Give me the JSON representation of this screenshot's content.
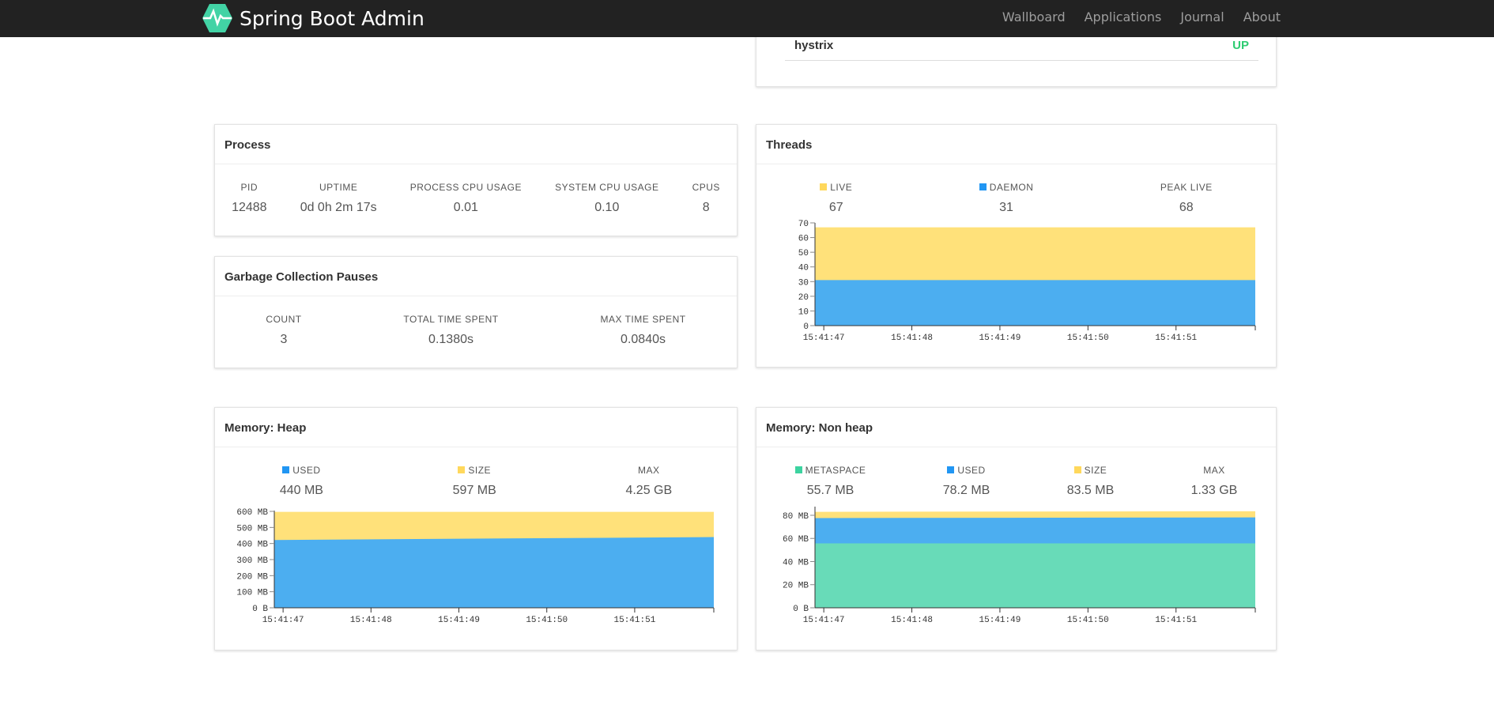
{
  "navbar": {
    "brand": "Spring Boot Admin",
    "links": [
      "Wallboard",
      "Applications",
      "Journal",
      " About"
    ]
  },
  "health": {
    "name": "hystrix",
    "status": "UP",
    "status_color": "#2ecc71"
  },
  "process": {
    "title": "Process",
    "stats": [
      {
        "label": "PID",
        "value": "12488"
      },
      {
        "label": "UPTIME",
        "value": "0d 0h 2m 17s"
      },
      {
        "label": "PROCESS CPU USAGE",
        "value": "0.01"
      },
      {
        "label": "SYSTEM CPU USAGE",
        "value": "0.10"
      },
      {
        "label": "CPUS",
        "value": "8"
      }
    ]
  },
  "gc": {
    "title": "Garbage Collection Pauses",
    "stats": [
      {
        "label": "COUNT",
        "value": "3"
      },
      {
        "label": "TOTAL TIME SPENT",
        "value": "0.1380s"
      },
      {
        "label": "MAX TIME SPENT",
        "value": "0.0840s"
      }
    ]
  },
  "threads": {
    "title": "Threads",
    "stats": [
      {
        "label": "LIVE",
        "value": "67",
        "color": "#ffd85c"
      },
      {
        "label": "DAEMON",
        "value": "31",
        "color": "#2196f3"
      },
      {
        "label": "PEAK LIVE",
        "value": "68"
      }
    ]
  },
  "heap": {
    "title": "Memory: Heap",
    "stats": [
      {
        "label": "USED",
        "value": "440 MB",
        "color": "#2196f3"
      },
      {
        "label": "SIZE",
        "value": "597 MB",
        "color": "#ffd85c"
      },
      {
        "label": "MAX",
        "value": "4.25 GB"
      }
    ]
  },
  "nonheap": {
    "title": "Memory: Non heap",
    "stats": [
      {
        "label": "METASPACE",
        "value": "55.7 MB",
        "color": "#3cd3a0"
      },
      {
        "label": "USED",
        "value": "78.2 MB",
        "color": "#2196f3"
      },
      {
        "label": "SIZE",
        "value": "83.5 MB",
        "color": "#ffd85c"
      },
      {
        "label": "MAX",
        "value": "1.33 GB"
      }
    ]
  },
  "chart_data": [
    {
      "type": "area",
      "id": "threads",
      "x": [
        "15:41:46.9",
        "15:41:51.9"
      ],
      "xticks": [
        "15:41:47",
        "15:41:48",
        "15:41:49",
        "15:41:50",
        "15:41:51"
      ],
      "ylim": [
        0,
        70
      ],
      "yticks": [
        "0",
        "10",
        "20",
        "30",
        "40",
        "50",
        "60",
        "70"
      ],
      "ytick_values": [
        0,
        10,
        20,
        30,
        40,
        50,
        60,
        70
      ],
      "series": [
        {
          "name": "LIVE",
          "color": "#ffe17a",
          "values": [
            67,
            67
          ]
        },
        {
          "name": "DAEMON",
          "color": "#4caef0",
          "values": [
            31,
            31
          ]
        }
      ]
    },
    {
      "type": "area",
      "id": "heap",
      "x": [
        "15:41:46.9",
        "15:41:51.9"
      ],
      "xticks": [
        "15:41:47",
        "15:41:48",
        "15:41:49",
        "15:41:50",
        "15:41:51"
      ],
      "ylim": [
        0,
        605
      ],
      "yticks": [
        "0 B",
        "100 MB",
        "200 MB",
        "300 MB",
        "400 MB",
        "500 MB",
        "600 MB"
      ],
      "ytick_values": [
        0,
        100,
        200,
        300,
        400,
        500,
        600
      ],
      "series": [
        {
          "name": "SIZE",
          "color": "#ffe17a",
          "values": [
            597,
            597
          ]
        },
        {
          "name": "USED",
          "color": "#4caef0",
          "values": [
            422,
            440
          ]
        }
      ]
    },
    {
      "type": "area",
      "id": "nonheap",
      "x": [
        "15:41:46.9",
        "15:41:51.9"
      ],
      "xticks": [
        "15:41:47",
        "15:41:48",
        "15:41:49",
        "15:41:50",
        "15:41:51"
      ],
      "ylim": [
        0,
        87.5
      ],
      "yticks": [
        "0 B",
        "20 MB",
        "40 MB",
        "60 MB",
        "80 MB"
      ],
      "ytick_values": [
        0,
        20,
        40,
        60,
        80
      ],
      "series": [
        {
          "name": "SIZE",
          "color": "#ffe17a",
          "values": [
            83,
            83.5
          ]
        },
        {
          "name": "USED",
          "color": "#4caef0",
          "values": [
            77.6,
            78.2
          ]
        },
        {
          "name": "METASPACE",
          "color": "#68dbb8",
          "values": [
            55.7,
            55.7
          ]
        }
      ]
    }
  ]
}
